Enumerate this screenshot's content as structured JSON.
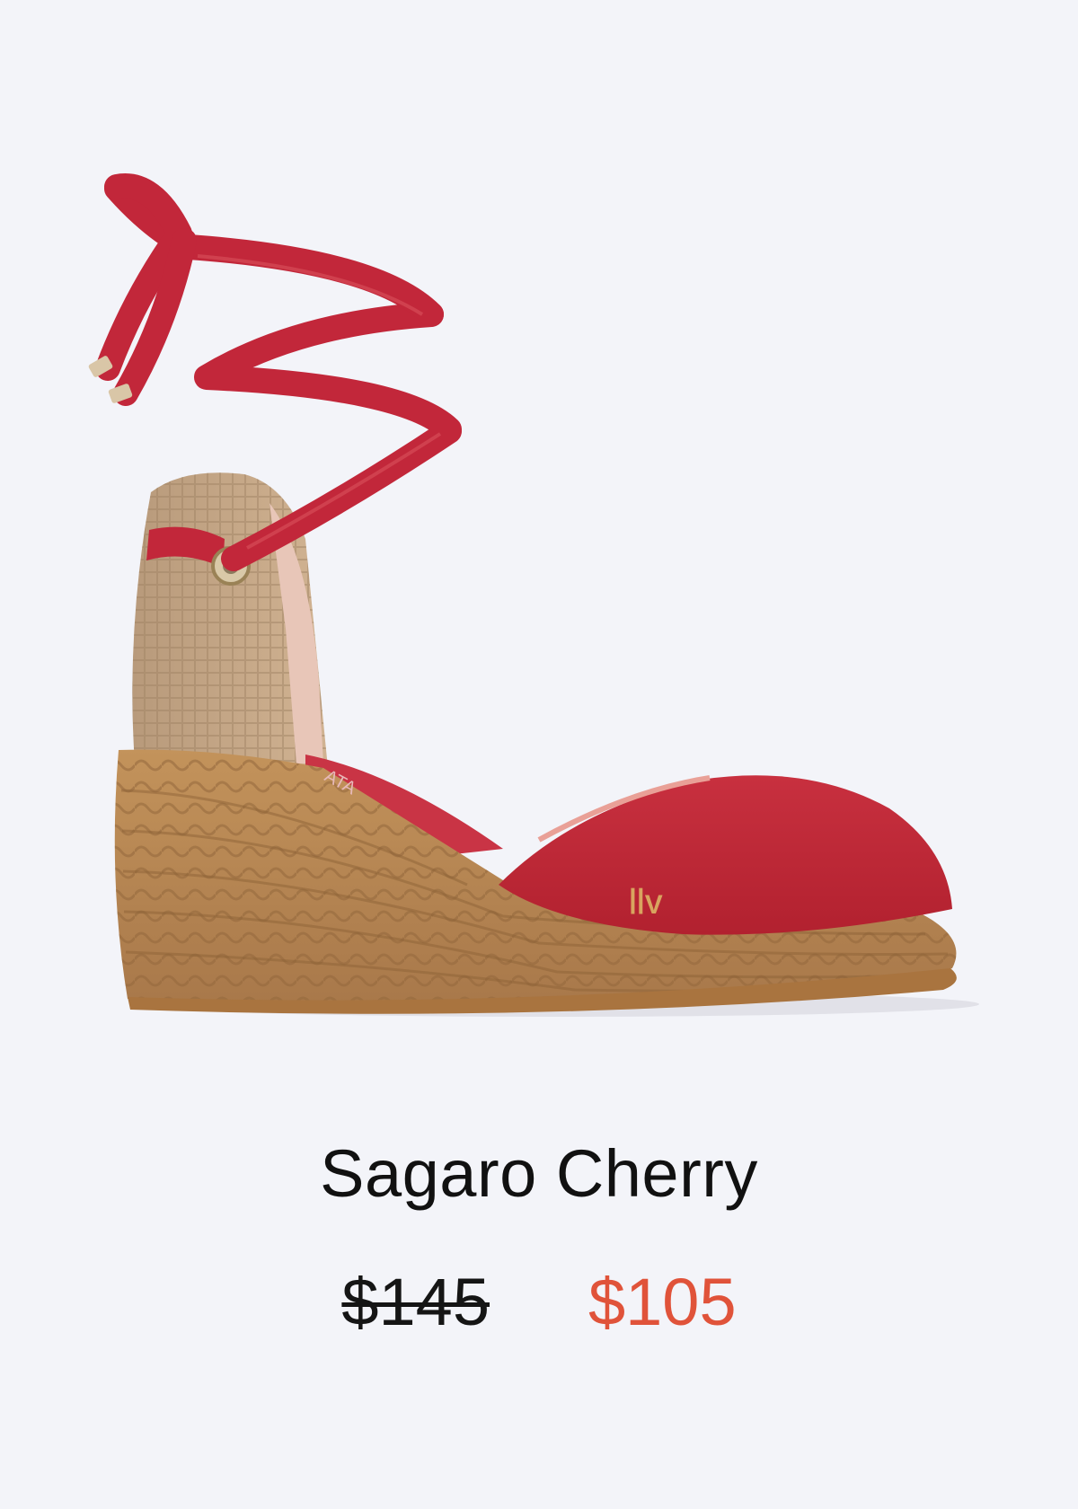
{
  "product": {
    "name": "Sagaro Cherry",
    "original_price": "$145",
    "sale_price": "$105",
    "image_icon": "espadrille-wedge-image",
    "colors": {
      "background": "#f3f4f9",
      "canvas_red": "#c2273a",
      "jute": "#b88a55",
      "sale_price": "#e0533a"
    }
  }
}
